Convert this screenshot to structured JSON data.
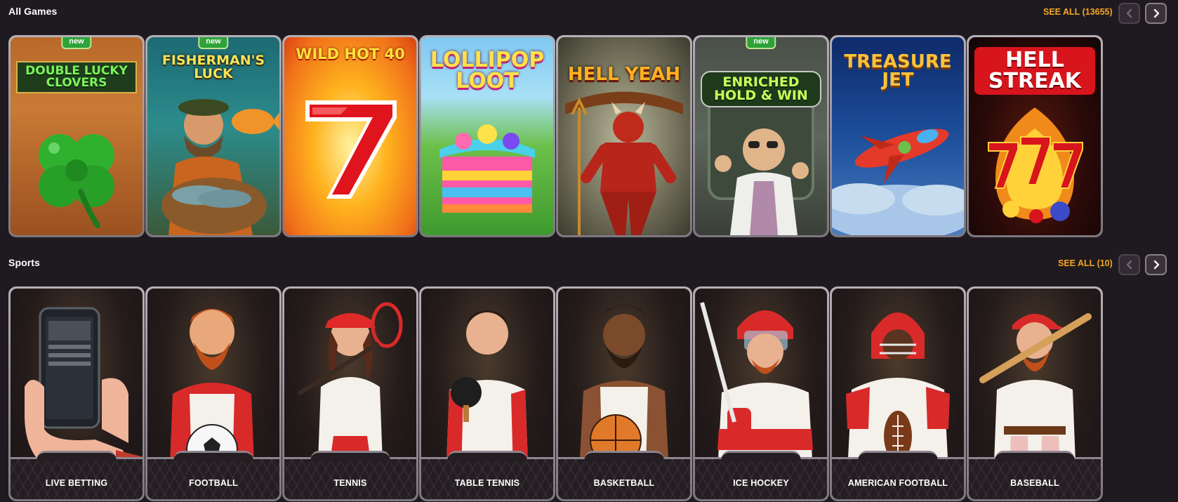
{
  "all_games": {
    "title": "All Games",
    "see_all": "SEE ALL (13655)",
    "prev_icon": "chevron-left-icon",
    "next_icon": "chevron-right-icon",
    "games": [
      {
        "title": "DOUBLE LUCKY CLOVERS",
        "badge": "new",
        "icon": "clover-icon"
      },
      {
        "title": "FISHERMAN'S LUCK",
        "badge": "new",
        "icon": "fisherman-icon"
      },
      {
        "title": "WILD HOT 40",
        "badge": "",
        "icon": "seven-icon"
      },
      {
        "title": "LOLLIPOP LOOT",
        "badge": "",
        "icon": "cake-icon"
      },
      {
        "title": "HELL YEAH",
        "badge": "",
        "icon": "devil-icon"
      },
      {
        "title": "ENRICHED HOLD & WIN",
        "badge": "new",
        "icon": "scientist-icon"
      },
      {
        "title": "TREASURE JET",
        "badge": "",
        "icon": "jet-icon"
      },
      {
        "title": "HELL STREAK",
        "badge": "",
        "icon": "triple-seven-icon"
      }
    ]
  },
  "sports": {
    "title": "Sports",
    "see_all": "SEE ALL (10)",
    "items": [
      {
        "label": "LIVE BETTING",
        "icon": "phone-icon"
      },
      {
        "label": "FOOTBALL",
        "icon": "football-player-icon"
      },
      {
        "label": "TENNIS",
        "icon": "tennis-player-icon"
      },
      {
        "label": "TABLE TENNIS",
        "icon": "table-tennis-player-icon"
      },
      {
        "label": "BASKETBALL",
        "icon": "basketball-player-icon"
      },
      {
        "label": "ICE HOCKEY",
        "icon": "hockey-player-icon"
      },
      {
        "label": "AMERICAN FOOTBALL",
        "icon": "american-football-player-icon"
      },
      {
        "label": "BASEBALL",
        "icon": "baseball-player-icon"
      }
    ]
  },
  "colors": {
    "background": "#1e1a1f",
    "accent": "#f5a623",
    "badge": "#2fa23a"
  }
}
